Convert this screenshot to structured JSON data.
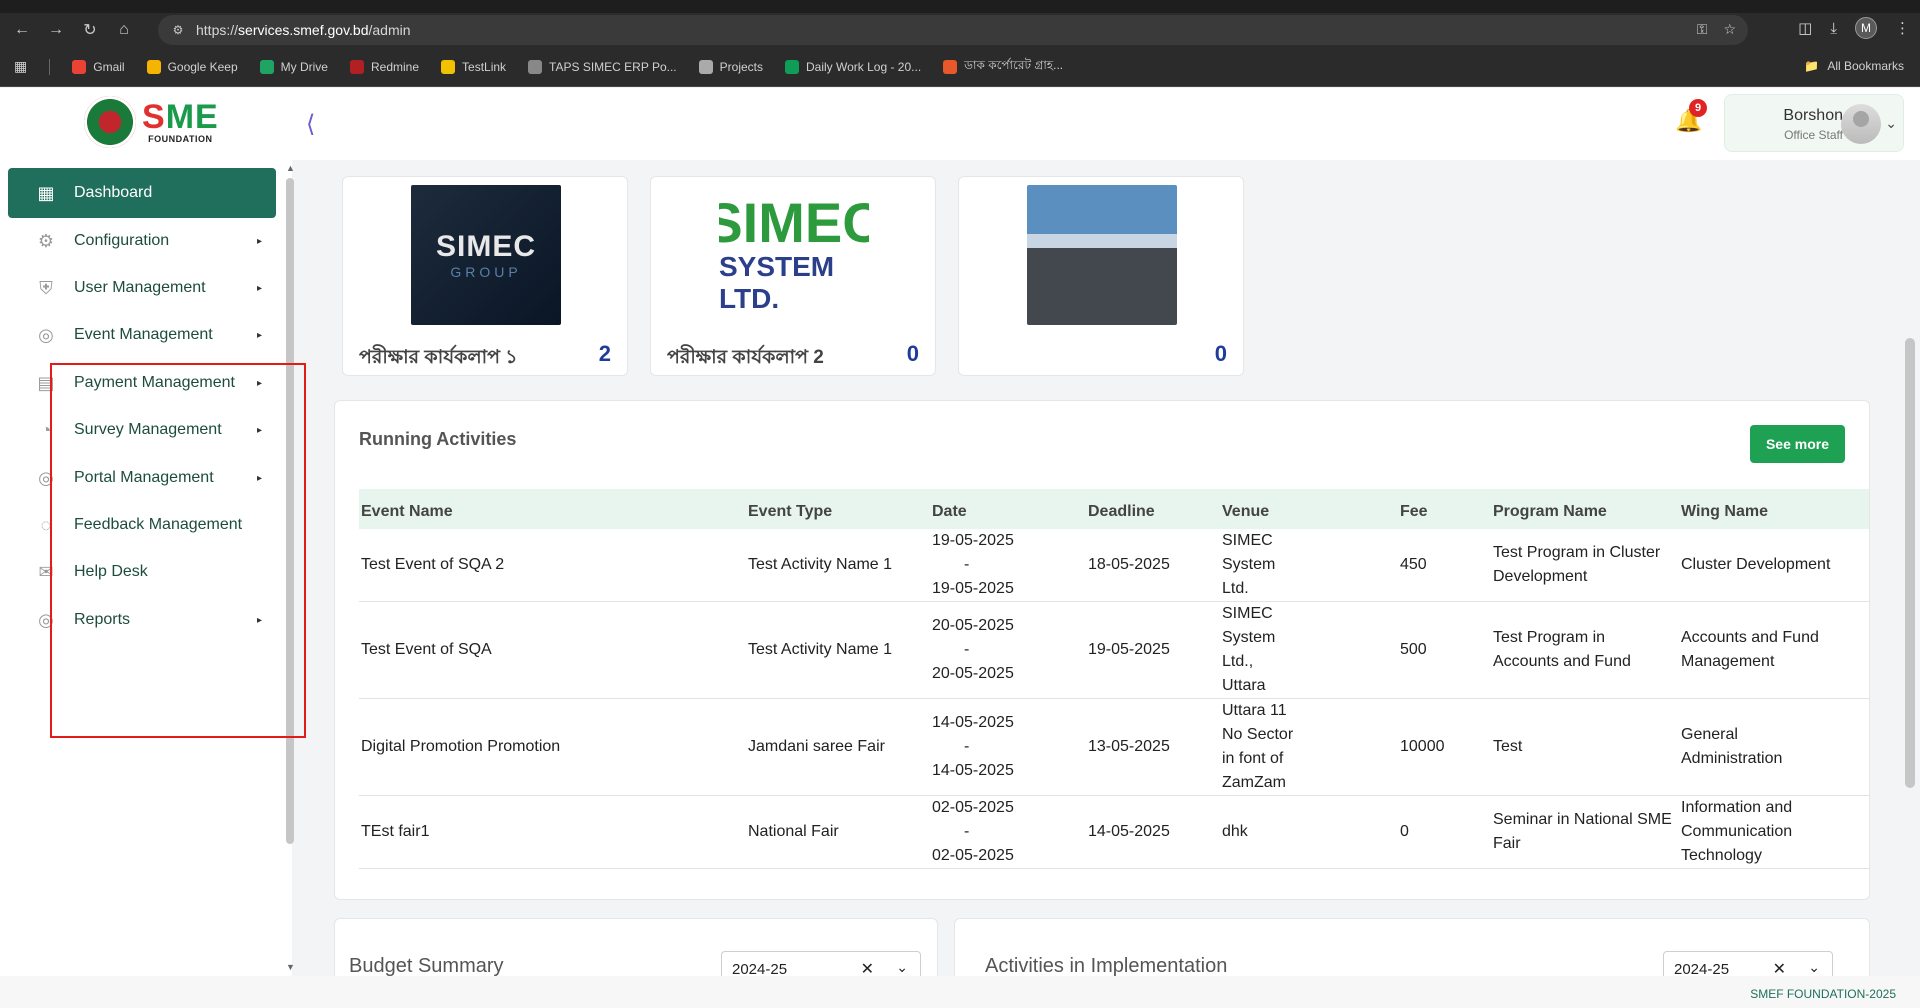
{
  "browser": {
    "url_prefix": "https://",
    "url_domain": "services.smef.gov.bd",
    "url_path": "/admin",
    "profile_initial": "M",
    "bookmarks": [
      {
        "label": "Gmail",
        "color": "#ea4335"
      },
      {
        "label": "Google Keep",
        "color": "#f4b400"
      },
      {
        "label": "My Drive",
        "color": "#1fa463"
      },
      {
        "label": "Redmine",
        "color": "#b32024"
      },
      {
        "label": "TestLink",
        "color": "#f2c200"
      },
      {
        "label": "TAPS SIMEC ERP Po...",
        "color": "#888888"
      },
      {
        "label": "Projects",
        "color": "#aaaaaa"
      },
      {
        "label": "Daily Work Log - 20...",
        "color": "#0f9d58"
      },
      {
        "label": "ডাক কর্পোরেট গ্রাহ...",
        "color": "#e8582b"
      }
    ],
    "all_bookmarks": "All Bookmarks"
  },
  "header": {
    "logo_text": "SME",
    "logo_sub": "FOUNDATION",
    "notification_count": "9",
    "user_name": "Borshon",
    "user_role": "Office Staff"
  },
  "sidebar": {
    "items": [
      {
        "label": "Dashboard",
        "icon": "grid-icon",
        "active": true
      },
      {
        "label": "Configuration",
        "icon": "config-icon"
      },
      {
        "label": "User Management",
        "icon": "shield-icon"
      },
      {
        "label": "Event Management",
        "icon": "event-icon"
      },
      {
        "label": "Payment Management",
        "icon": "payment-icon"
      },
      {
        "label": "Survey Management",
        "icon": "pie-icon"
      },
      {
        "label": "Portal Management",
        "icon": "portal-icon"
      },
      {
        "label": "Feedback Management",
        "icon": "feedback-icon"
      },
      {
        "label": "Help Desk",
        "icon": "mail-icon"
      },
      {
        "label": "Reports",
        "icon": "report-icon"
      }
    ]
  },
  "cards": [
    {
      "label": "পরীক্ষার কার্যকলাপ ১",
      "count": "2",
      "thumb_t1": "SIMEC",
      "thumb_t2": "GROUP"
    },
    {
      "label": "পরীক্ষার কার্যকলাপ 2",
      "count": "0",
      "thumb_t1": "SIMEC",
      "thumb_t2": "SYSTEM LTD."
    },
    {
      "label": "",
      "count": "0"
    }
  ],
  "activities": {
    "title": "Running Activities",
    "see_more": "See more",
    "columns": [
      "Event Name",
      "Event Type",
      "Date",
      "Deadline",
      "Venue",
      "Fee",
      "Program Name",
      "Wing Name"
    ],
    "rows": [
      {
        "event_name": "Test Event of SQA 2",
        "event_type": "Test Activity Name 1",
        "date_from": "19-05-2025",
        "date_sep": "-",
        "date_to": "19-05-2025",
        "deadline": "18-05-2025",
        "venue": [
          "SIMEC",
          "System",
          "Ltd."
        ],
        "fee": "450",
        "program": [
          "Test Program in Cluster",
          "Development"
        ],
        "wing": [
          "Cluster Development"
        ]
      },
      {
        "event_name": "Test Event of SQA",
        "event_type": "Test Activity Name 1",
        "date_from": "20-05-2025",
        "date_sep": "-",
        "date_to": "20-05-2025",
        "deadline": "19-05-2025",
        "venue": [
          "SIMEC",
          "System",
          "Ltd.,",
          "Uttara"
        ],
        "fee": "500",
        "program": [
          "Test Program in",
          "Accounts and Fund"
        ],
        "wing": [
          "Accounts and Fund",
          "Management"
        ]
      },
      {
        "event_name": "Digital Promotion Promotion",
        "event_type": "Jamdani saree Fair",
        "date_from": "14-05-2025",
        "date_sep": "-",
        "date_to": "14-05-2025",
        "deadline": "13-05-2025",
        "venue": [
          "Uttara 11",
          "No Sector",
          "in font of",
          "ZamZam"
        ],
        "fee": "10000",
        "program": [
          "Test"
        ],
        "wing": [
          "General",
          "Administration"
        ]
      },
      {
        "event_name": "TEst fair1",
        "event_type": "National Fair",
        "date_from": "02-05-2025",
        "date_sep": "-",
        "date_to": "02-05-2025",
        "deadline": "14-05-2025",
        "venue": [
          "dhk"
        ],
        "fee": "0",
        "program": [
          "Seminar in National SME",
          "Fair"
        ],
        "wing": [
          "Information and",
          "Communication",
          "Technology"
        ]
      }
    ]
  },
  "budget": {
    "title": "Budget Summary",
    "year": "2024-25"
  },
  "implementation": {
    "title": "Activities in Implementation",
    "year": "2024-25"
  },
  "footer": {
    "text": "SMEF FOUNDATION-2025"
  }
}
